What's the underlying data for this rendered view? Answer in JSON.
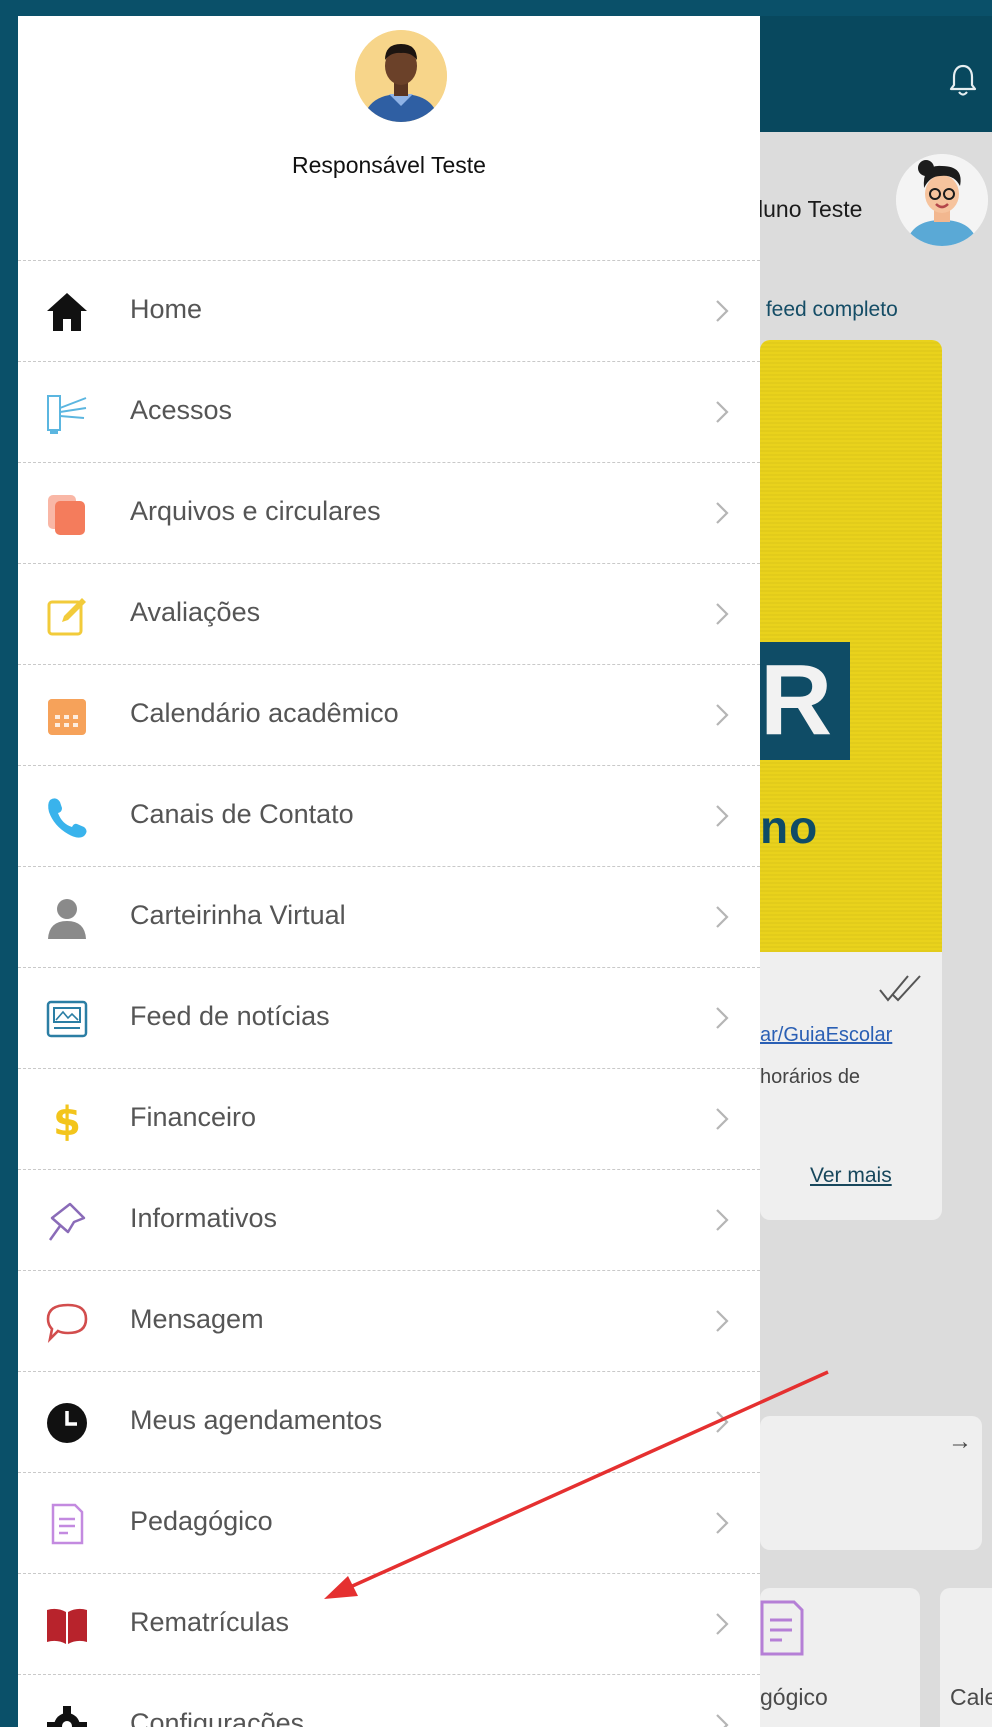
{
  "header": {
    "notifications_icon": "bell-icon"
  },
  "student": {
    "name": "luno Teste",
    "avatar_icon": "student-avatar"
  },
  "feed": {
    "view_full_link": "r feed completo",
    "banner_letter": "R",
    "banner_word": "no",
    "link_text": "ar/GuiaEscolar",
    "snippet": "horários de",
    "read_more": "Ver mais"
  },
  "quick_actions": {
    "arrow": "→"
  },
  "tiles": [
    {
      "label": "gógico",
      "icon": "document-icon"
    },
    {
      "label": "Caler"
    }
  ],
  "drawer": {
    "user_name": "Responsável Teste",
    "menu": [
      {
        "label": "Home",
        "icon": "home-icon",
        "color": "#111111"
      },
      {
        "label": "Acessos",
        "icon": "turnstile-icon",
        "color": "#5bb6e0"
      },
      {
        "label": "Arquivos e circulares",
        "icon": "files-icon",
        "color": "#f47c5c"
      },
      {
        "label": "Avaliações",
        "icon": "edit-note-icon",
        "color": "#f2cb3a"
      },
      {
        "label": "Calendário acadêmico",
        "icon": "calendar-icon",
        "color": "#f6a25a"
      },
      {
        "label": "Canais de Contato",
        "icon": "phone-icon",
        "color": "#39b3ec"
      },
      {
        "label": "Carteirinha Virtual",
        "icon": "person-icon",
        "color": "#8a8a8a"
      },
      {
        "label": "Feed de notícias",
        "icon": "news-icon",
        "color": "#2b7ea4"
      },
      {
        "label": "Financeiro",
        "icon": "dollar-icon",
        "color": "#f3c51c"
      },
      {
        "label": "Informativos",
        "icon": "pin-icon",
        "color": "#8a6bb8"
      },
      {
        "label": "Mensagem",
        "icon": "chat-icon",
        "color": "#d24d4d"
      },
      {
        "label": "Meus agendamentos",
        "icon": "clock-icon",
        "color": "#111111"
      },
      {
        "label": "Pedagógico",
        "icon": "document-icon",
        "color": "#c38ae0"
      },
      {
        "label": "Rematrículas",
        "icon": "book-icon",
        "color": "#b8232c"
      },
      {
        "label": "Configurações",
        "icon": "gear-icon",
        "color": "#111111"
      }
    ]
  },
  "annotation": {
    "arrow_color": "#e53030"
  }
}
